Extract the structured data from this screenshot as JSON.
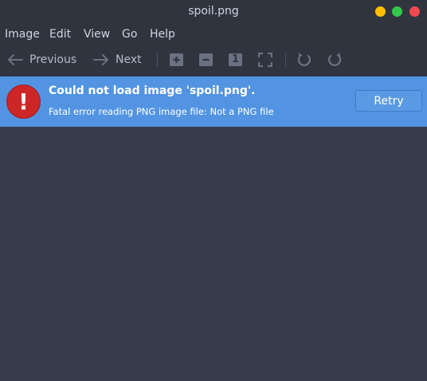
{
  "window": {
    "title": "spoil.png"
  },
  "menu": [
    "Image",
    "Edit",
    "View",
    "Go",
    "Help"
  ],
  "toolbar": {
    "previous_label": "Previous",
    "next_label": "Next",
    "icons": [
      "zoom-in-icon",
      "zoom-out-icon",
      "zoom-normal-icon",
      "fit-icon",
      "rotate-left-icon",
      "rotate-right-icon"
    ],
    "normal_size_glyph": "1"
  },
  "error": {
    "title": "Could not load image 'spoil.png'.",
    "message": "Fatal error reading PNG image file: Not a PNG file",
    "retry_label": "Retry",
    "icon_glyph": "!"
  },
  "colors": {
    "background": "#383c4a",
    "chrome": "#2f343f",
    "infobar": "#5294e2",
    "error_icon": "#cc2627",
    "close": "#f04a50",
    "minimize": "#fdbe04",
    "maximize": "#34c84a"
  }
}
